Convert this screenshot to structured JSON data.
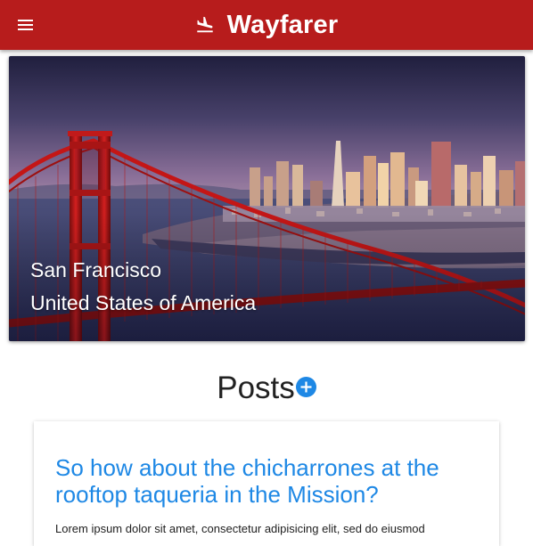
{
  "app_bar": {
    "brand_title": "Wayfarer",
    "background_color": "#b71c1c",
    "menu_icon": "hamburger-menu-icon",
    "brand_icon": "flight-landing-icon"
  },
  "city": {
    "name": "San Francisco",
    "country": "United States of America",
    "photo": "golden-gate-bridge-skyline-photo"
  },
  "posts_section": {
    "title": "Posts",
    "add_icon": "add-circle-icon",
    "accent_color": "#1e88e5"
  },
  "posts": [
    {
      "title": "So how about the chicharrones at the rooftop taqueria in the Mission?",
      "excerpt": "Lorem ipsum dolor sit amet, consectetur adipisicing elit, sed do eiusmod"
    }
  ]
}
